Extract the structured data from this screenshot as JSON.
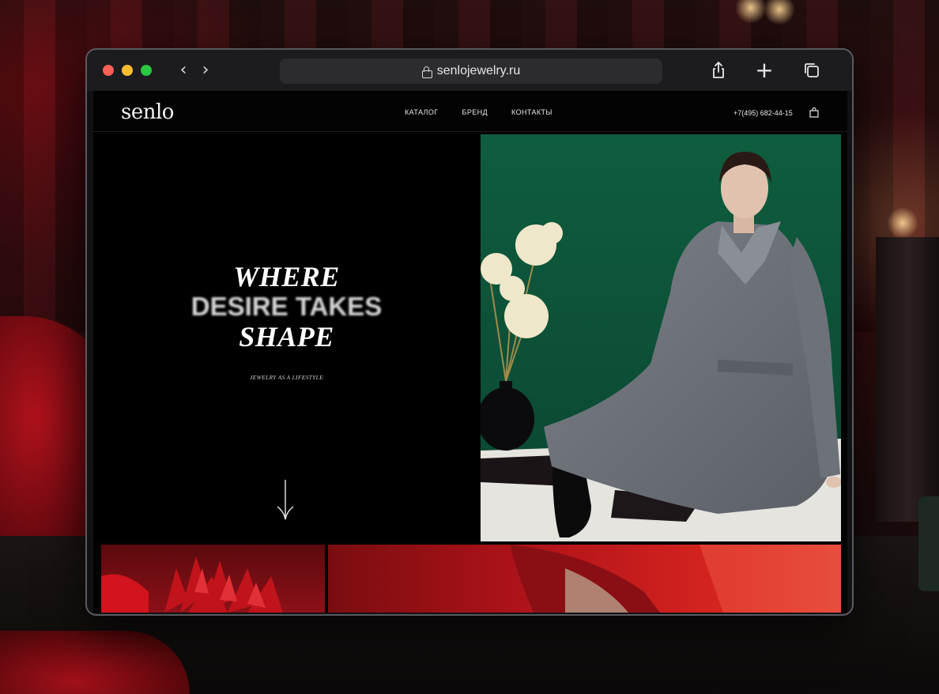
{
  "browser": {
    "url": "senlojewelry.ru"
  },
  "site": {
    "logo": "senlo",
    "nav": [
      {
        "label": "КАТАЛОГ"
      },
      {
        "label": "БРЕНД"
      },
      {
        "label": "КОНТАКТЫ"
      }
    ],
    "phone": "+7(495) 682-44-15",
    "hero": {
      "line1": "WHERE",
      "line2": "DESIRE TAKES",
      "line3": "SHAPE",
      "tagline": "JEWELRY AS A LIFESTYLE"
    }
  },
  "colors": {
    "site_background": "#030303",
    "hero_photo_green": "#0e5a3d",
    "accent_red": "#b1131a",
    "text": "#ffffff"
  },
  "icons": [
    "lock-icon",
    "back-chevron-icon",
    "forward-chevron-icon",
    "share-icon",
    "plus-icon",
    "tabs-icon",
    "shopping-bag-icon",
    "down-arrow-icon"
  ]
}
